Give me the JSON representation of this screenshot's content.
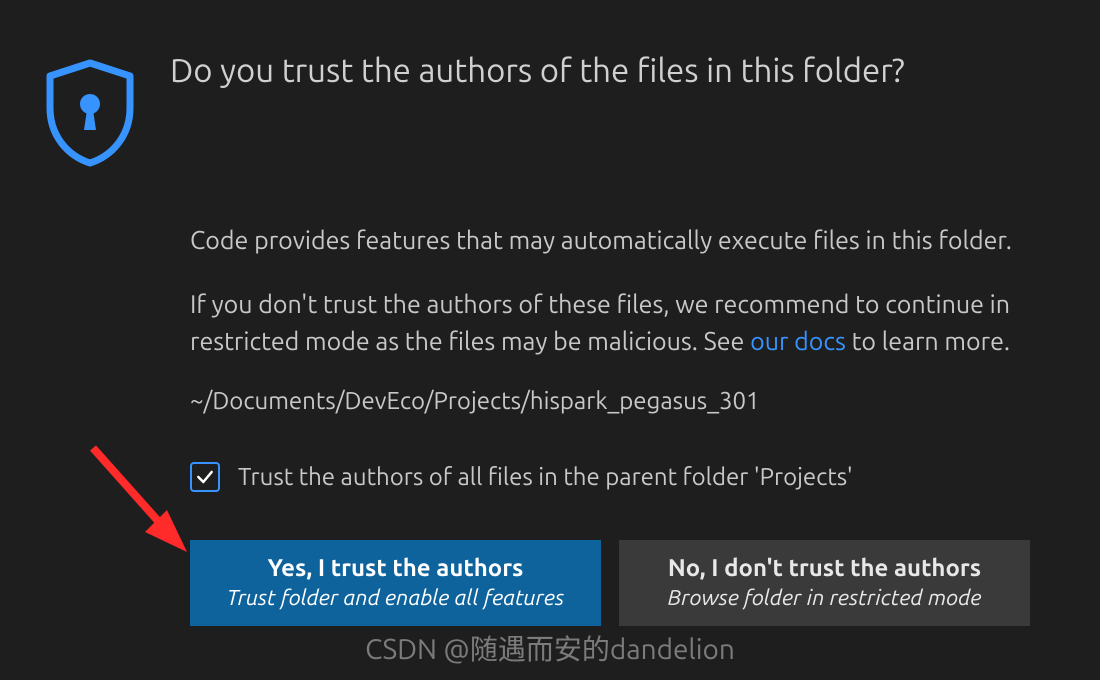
{
  "dialog": {
    "title": "Do you trust the authors of the files in this folder?",
    "paragraph1": "Code provides features that may automatically execute files in this folder.",
    "paragraph2_pre": "If you don't trust the authors of these files, we recommend to continue in restricted mode as the files may be malicious. See ",
    "docs_link_text": "our docs",
    "paragraph2_post": " to learn more.",
    "folder_path": "~/Documents/DevEco/Projects/hispark_pegasus_301",
    "checkbox_label": "Trust the authors of all files in the parent folder 'Projects'",
    "checkbox_checked": true,
    "buttons": {
      "trust": {
        "title": "Yes, I trust the authors",
        "subtitle": "Trust folder and enable all features"
      },
      "no_trust": {
        "title": "No, I don't trust the authors",
        "subtitle": "Browse folder in restricted mode"
      }
    }
  },
  "watermark": "CSDN @随遇而安的dandelion",
  "colors": {
    "accent": "#3794ff",
    "primary_btn": "#0e639c",
    "bg": "#1e1e1e"
  }
}
